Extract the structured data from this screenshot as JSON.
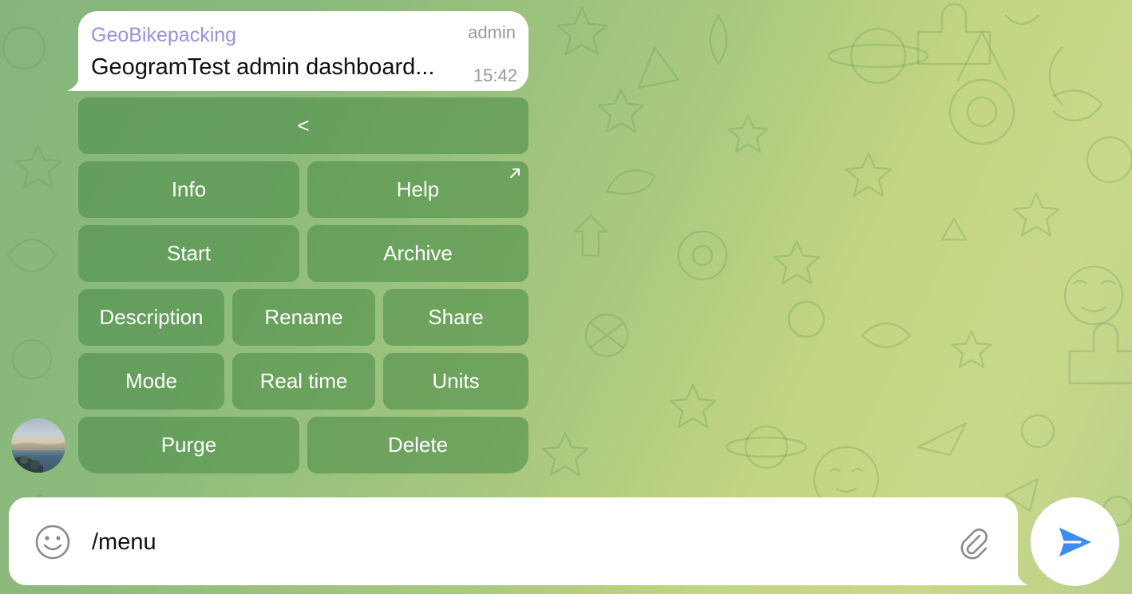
{
  "message": {
    "sender": "GeoBikepacking",
    "role": "admin",
    "text": "GeogramTest admin dashboard...",
    "time": "15:42"
  },
  "keyboard": {
    "back": "<",
    "info": "Info",
    "help": "Help",
    "start": "Start",
    "archive": "Archive",
    "description": "Description",
    "rename": "Rename",
    "share": "Share",
    "mode": "Mode",
    "real_time": "Real time",
    "units": "Units",
    "purge": "Purge",
    "delete": "Delete"
  },
  "composer": {
    "value": "/menu"
  },
  "icons": {
    "emoji": "smiley-face-icon",
    "attach": "paperclip-icon",
    "send": "send-arrow-icon",
    "help_link": "external-link-arrow-icon"
  },
  "colors": {
    "sender_name": "#a08ee0",
    "send_accent": "#3b8df0",
    "keyboard_button": "#5c9a56"
  }
}
